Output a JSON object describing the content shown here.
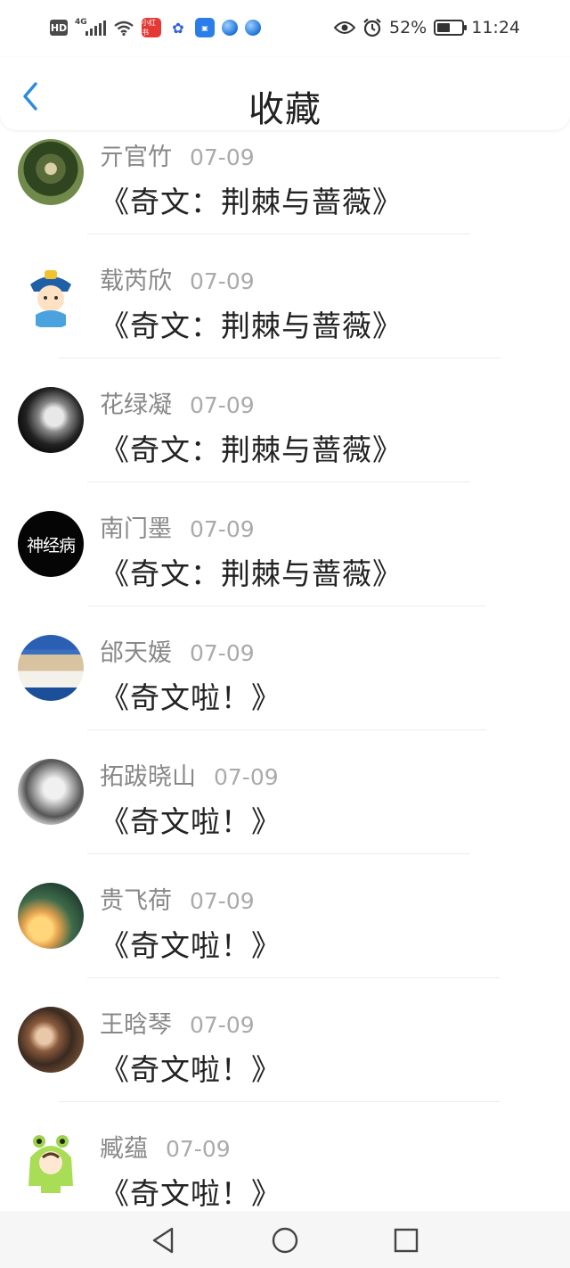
{
  "status_bar": {
    "hd": "HD",
    "network": "4G",
    "red_app": "小红书",
    "battery_percent": "52%",
    "battery_level": 0.52,
    "time": "11:24"
  },
  "header": {
    "title": "收藏"
  },
  "items": [
    {
      "name": "亓官竹",
      "date": "07-09",
      "title": "《奇文：荆棘与蔷薇》",
      "avatar": "forest-person-avatar"
    },
    {
      "name": "载芮欣",
      "date": "07-09",
      "title": "《奇文：荆棘与蔷薇》",
      "avatar": "cartoon-boy-avatar"
    },
    {
      "name": "花绿凝",
      "date": "07-09",
      "title": "《奇文：荆棘与蔷薇》",
      "avatar": "bw-portrait-avatar"
    },
    {
      "name": "南门墨",
      "date": "07-09",
      "title": "《奇文：荆棘与蔷薇》",
      "avatar": "calligraphy-avatar",
      "avatar_text": "神经病"
    },
    {
      "name": "邰天媛",
      "date": "07-09",
      "title": "《奇文啦！》",
      "avatar": "coffee-cup-avatar"
    },
    {
      "name": "拓跋晓山",
      "date": "07-09",
      "title": "《奇文啦！》",
      "avatar": "girl-portrait-avatar"
    },
    {
      "name": "贵飞荷",
      "date": "07-09",
      "title": "《奇文啦！》",
      "avatar": "child-lantern-avatar"
    },
    {
      "name": "王晗琴",
      "date": "07-09",
      "title": "《奇文啦！》",
      "avatar": "two-kids-avatar"
    },
    {
      "name": "臧蕴",
      "date": "07-09",
      "title": "《奇文啦！》",
      "avatar": "frog-hood-avatar"
    }
  ]
}
